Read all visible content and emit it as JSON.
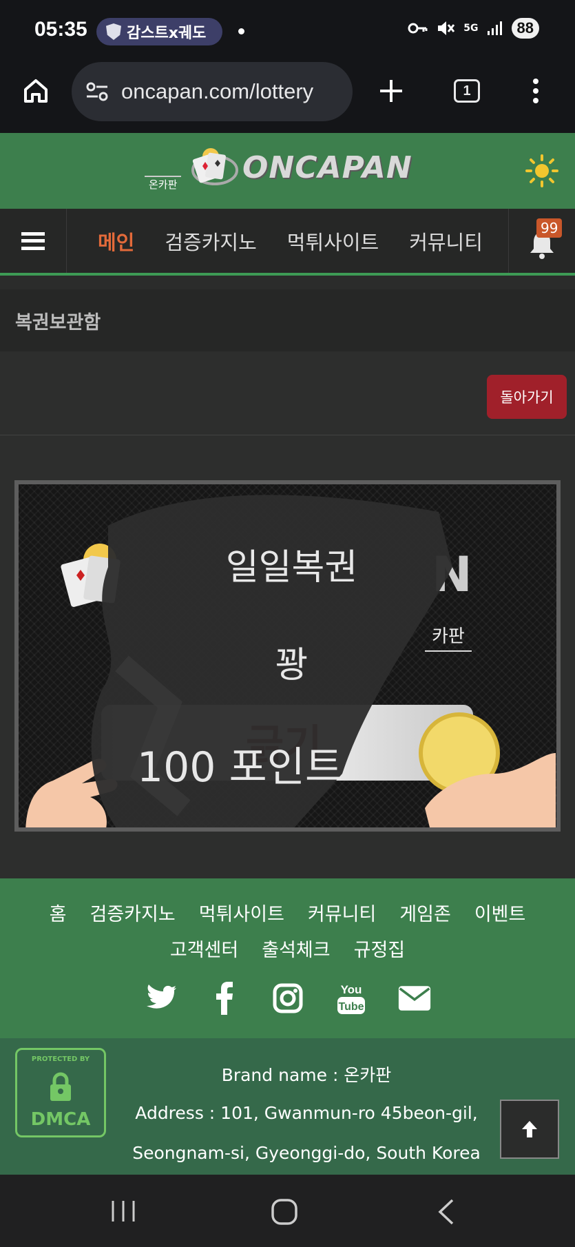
{
  "status_bar": {
    "time": "05:35",
    "notification_pill": "감스트x궤도",
    "battery": "88",
    "network": "5G"
  },
  "browser": {
    "url": "oncapan.com/lottery",
    "tab_count": "1"
  },
  "site": {
    "logo_text": "ONCAPAN",
    "logo_subtext": "온카판",
    "accent_color": "#3d7f4d"
  },
  "nav": {
    "items": [
      "메인",
      "검증카지노",
      "먹튀사이트",
      "커뮤니티"
    ],
    "notification_count": "99"
  },
  "page": {
    "section_title": "복권보관함",
    "back_button": "돌아가기"
  },
  "lottery": {
    "title": "일일복권",
    "result": "꽝",
    "amount": "100 포인트",
    "card_button_label": "긁기",
    "card_brand": "N",
    "card_brand_sub": "카판"
  },
  "footer": {
    "links_row1": [
      "홈",
      "검증카지노",
      "먹튀사이트",
      "커뮤니티",
      "게임존",
      "이벤트"
    ],
    "links_row2": [
      "고객센터",
      "출석체크",
      "규정집"
    ],
    "social_icons": [
      "twitter-icon",
      "facebook-icon",
      "instagram-icon",
      "youtube-icon",
      "email-icon"
    ],
    "dmca_top": "PROTECTED BY",
    "dmca_text": "DMCA",
    "brand_line": "Brand name : 온카판",
    "address_line1": "Address : 101, Gwanmun-ro 45beon-gil,",
    "address_line2": "Seongnam-si, Gyeonggi-do, South Korea"
  }
}
